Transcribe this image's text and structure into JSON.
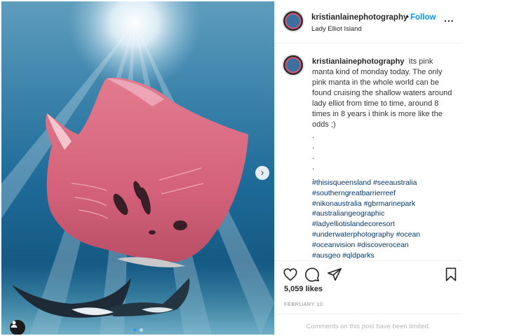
{
  "post": {
    "username": "kristianlainephotography",
    "separator": "•",
    "follow_label": "Follow",
    "location": "Lady Elliot Island",
    "more_label": "...",
    "caption_username": "kristianlainephotography",
    "caption_text": "Its pink manta kind of monday today. The only pink manta in the whole world can be found cruising the shallow waters around lady elliot from time to time, around 8 times in 8 years i think is more like the odds ;)",
    "filler_dots": [
      ".",
      ".",
      ".",
      ".",
      "."
    ],
    "hashtags": [
      "#thisisqueensland",
      "#seeaustralia",
      "#southerngreatbarrierreef",
      "#nikonaustralia",
      "#gbrmarinepark",
      "#australiangeographic",
      "#ladyelliotislandecoresort",
      "#underwaterphotography",
      "#ocean",
      "#oceanvision",
      "#discoverocean",
      "#ausgeo",
      "#qldparks"
    ],
    "likes": "5,059 likes",
    "date": "FEBRUARY 10",
    "comments_limited": "Comments on this post have been limited."
  },
  "icons": {
    "carousel_next": "›"
  },
  "colors": {
    "follow": "#0095f6",
    "hashtag": "#00376b",
    "manta": "#d9677c"
  }
}
